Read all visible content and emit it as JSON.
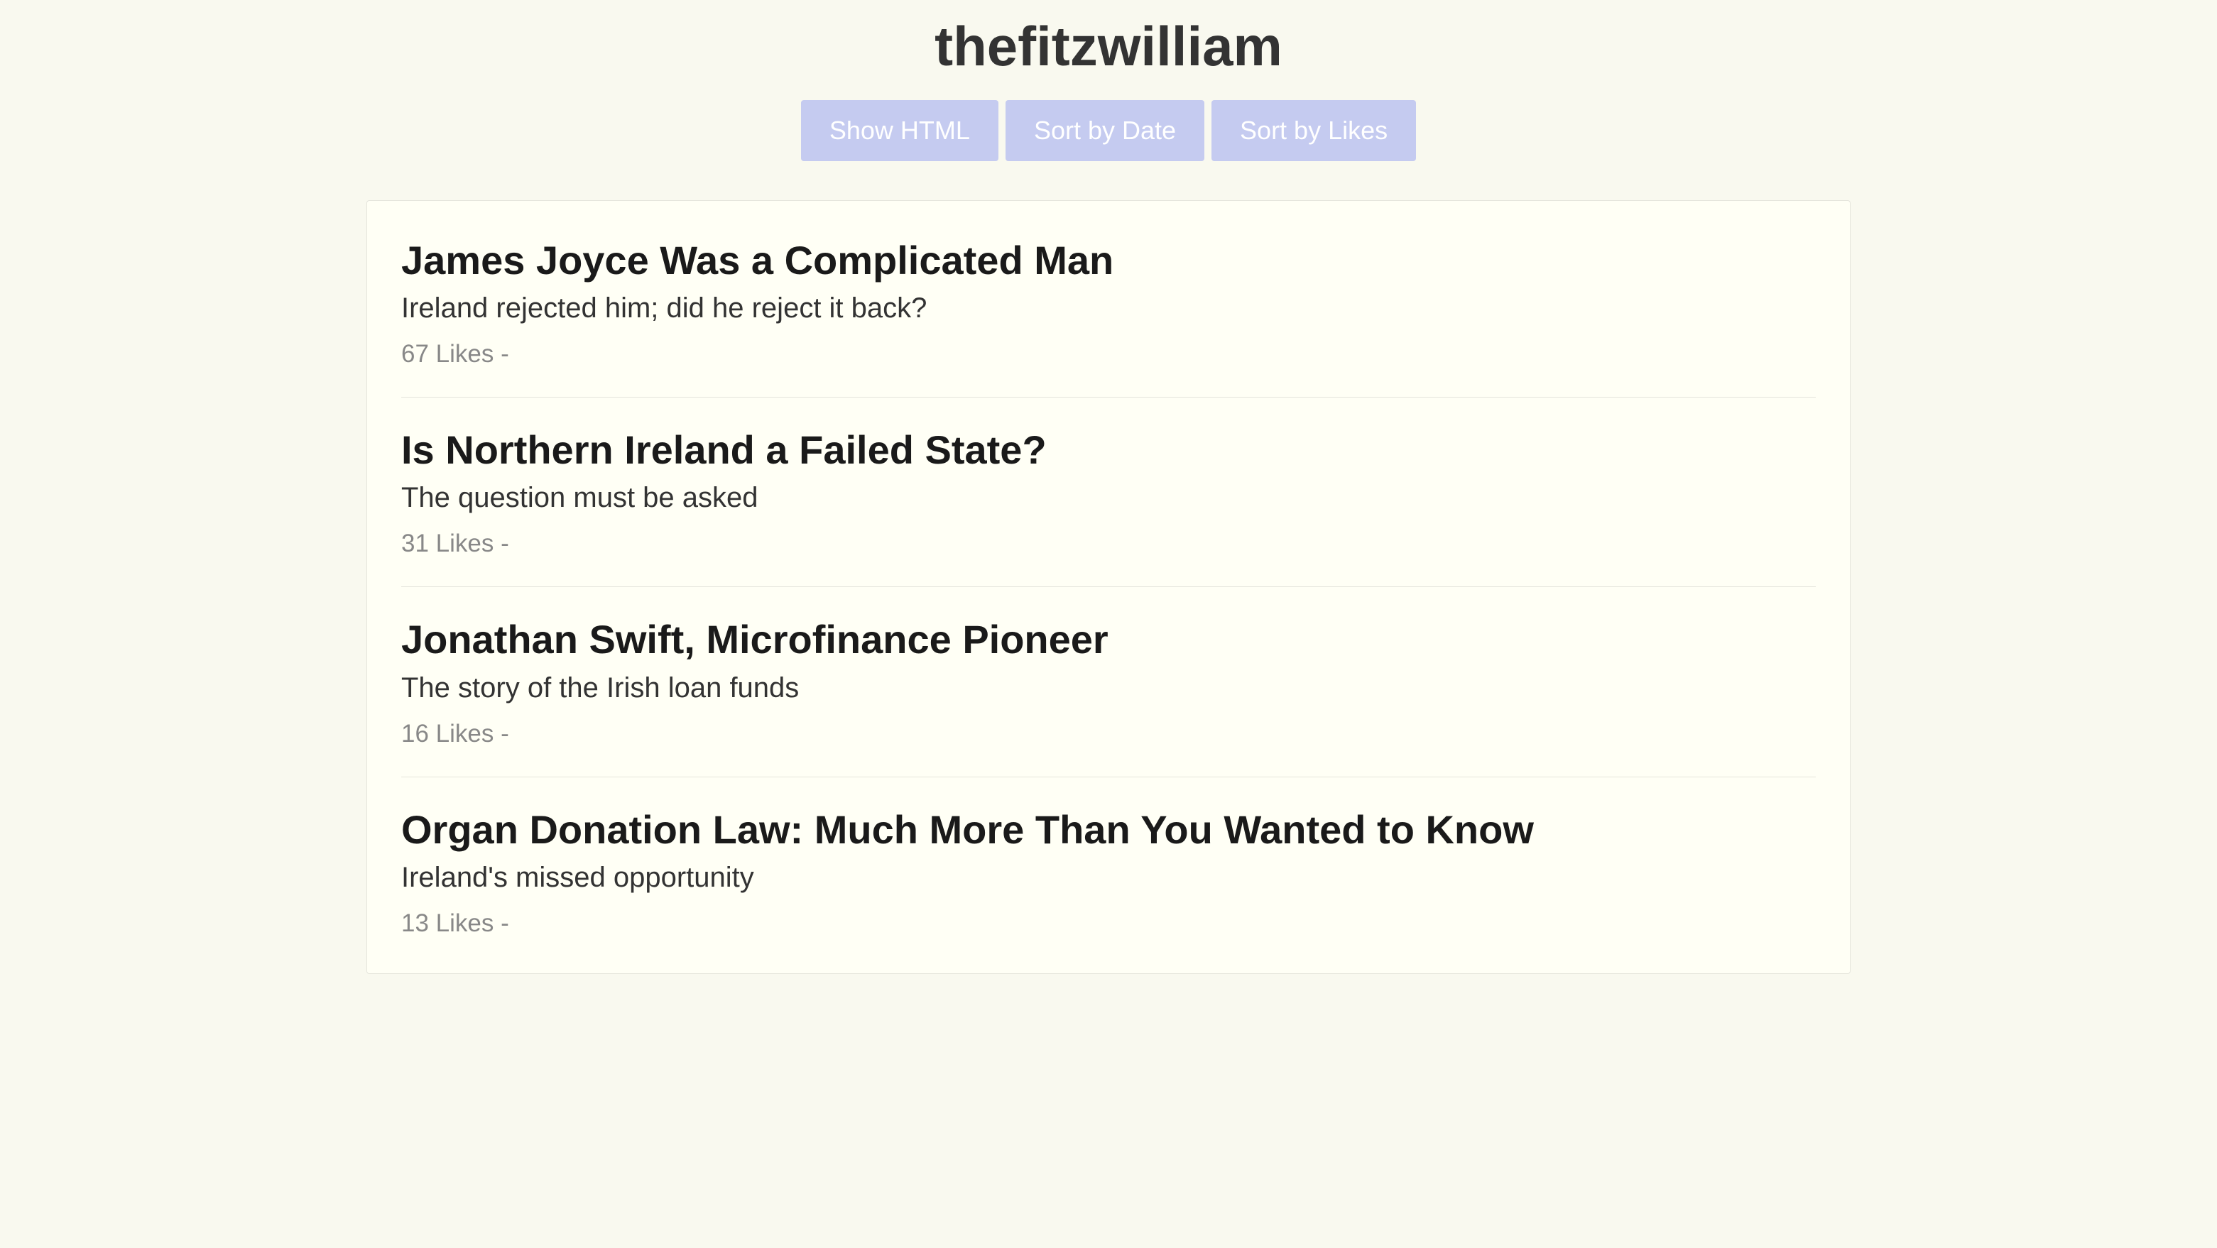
{
  "header": {
    "title": "thefitzwilliam"
  },
  "buttons": {
    "show_html": "Show HTML",
    "sort_date": "Sort by Date",
    "sort_likes": "Sort by Likes"
  },
  "posts": [
    {
      "title": "James Joyce Was a Complicated Man",
      "subtitle": "Ireland rejected him; did he reject it back?",
      "meta": "67 Likes -"
    },
    {
      "title": "Is Northern Ireland a Failed State?",
      "subtitle": "The question must be asked",
      "meta": "31 Likes -"
    },
    {
      "title": "Jonathan Swift, Microfinance Pioneer",
      "subtitle": "The story of the Irish loan funds",
      "meta": "16 Likes -"
    },
    {
      "title": "Organ Donation Law: Much More Than You Wanted to Know",
      "subtitle": "Ireland's missed opportunity",
      "meta": "13 Likes -"
    }
  ]
}
